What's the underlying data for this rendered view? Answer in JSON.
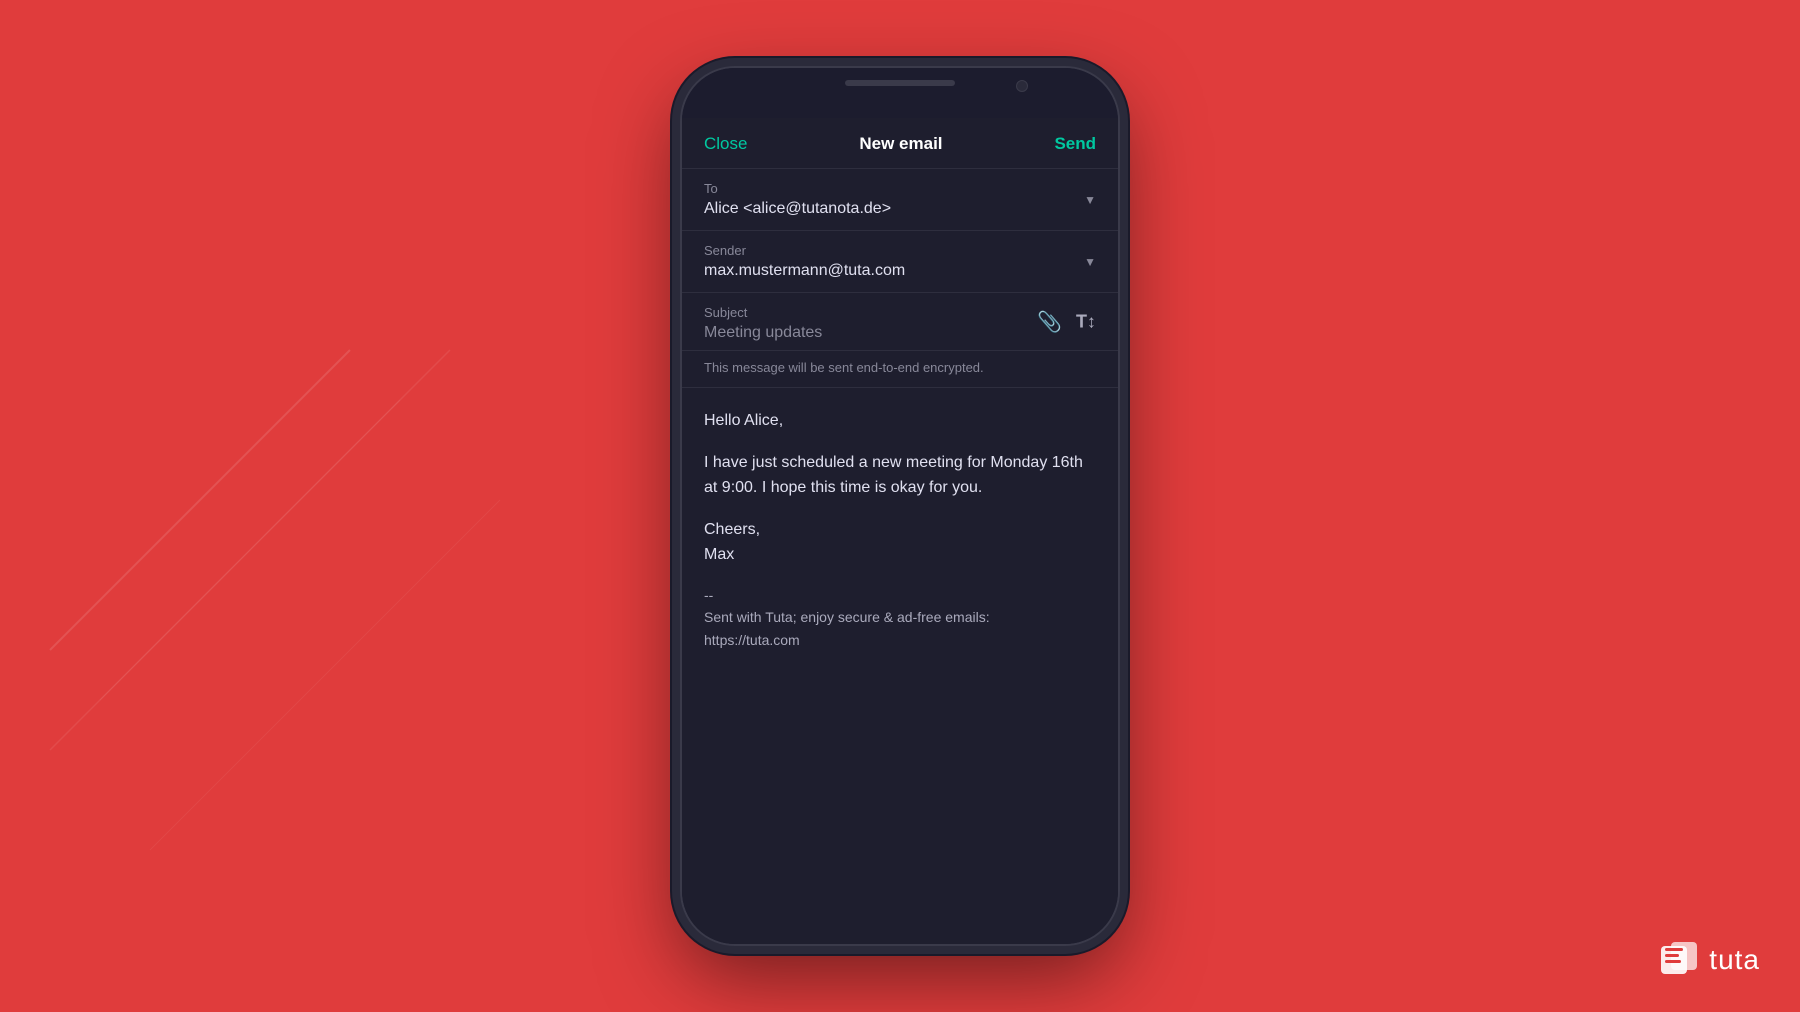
{
  "background": {
    "color": "#e03c3c"
  },
  "logo": {
    "text": "tuta",
    "alt": "Tuta logo"
  },
  "phone": {
    "nav": {
      "close_label": "Close",
      "title": "New email",
      "send_label": "Send"
    },
    "to_field": {
      "label": "To",
      "value": "Alice <alice@tutanota.de>"
    },
    "sender_field": {
      "label": "Sender",
      "value": "max.mustermann@tuta.com"
    },
    "subject_field": {
      "label": "Subject",
      "value": "Meeting updates"
    },
    "encryption_notice": "This message will be sent end-to-end encrypted.",
    "body": {
      "greeting": "Hello Alice,",
      "paragraph1": "I have just scheduled a new meeting for Monday 16th at 9:00. I hope this time is okay for you.",
      "closing": "Cheers,",
      "name": "Max",
      "separator": "--",
      "signature": "Sent with Tuta; enjoy secure & ad-free emails:\nhttps://tuta.com"
    }
  }
}
